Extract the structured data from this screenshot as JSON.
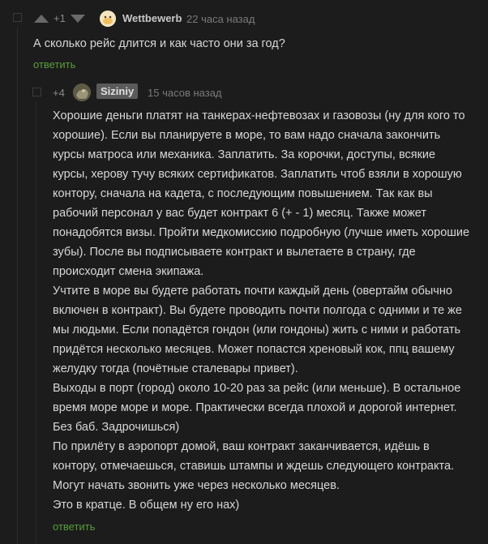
{
  "comment1": {
    "score": "+1",
    "username": "Wettbewerb",
    "time": "22 часа назад",
    "text": "А сколько рейс длится и как часто они за год?",
    "reply_label": "ответить"
  },
  "comment2": {
    "score": "+4",
    "username": "Siziniy",
    "time": "15 часов назад",
    "lines": [
      "Хорошие деньги платят на танкерах-нефтевозах и газовозы (ну для кого то",
      "хорошие). Если вы планируете в море, то вам надо сначала закончить",
      "курсы матроса или механика. Заплатить. За корочки, доступы, всякие",
      "курсы, херову тучу всяких сертификатов. Заплатить чтоб взяли в хорошую",
      "контору, сначала на кадета, с последующим повышением. Так как вы",
      "рабочий персонал у вас будет контракт 6 (+ - 1) месяц. Также может",
      "понадобятся визы. Пройти медкомиссию подробную (лучше иметь хорошие",
      "зубы). После вы подписываете контракт и вылетаете в страну, где",
      "происходит смена экипажа.",
      "Учтите в море вы будете работать почти каждый день (овертайм обычно",
      "включен в контракт). Вы будете проводить почти полгода с одними и те же",
      "мы людьми. Если попадётся гондон (или гондоны) жить с ними и работать",
      "придётся несколько месяцев. Может попастся хреновый кок, ппц вашему",
      "желудку тогда (почётные сталевары привет).",
      "Выходы в порт (город) около 10-20 раз за рейс (или меньше). В остальное",
      "время море море и море. Практически всегда плохой и дорогой интернет.",
      "Без баб. Задрочишься)",
      "По прилёту в аэропорт домой, ваш контракт заканчивается, идёшь в",
      "контору, отмечаешься, ставишь штампы и ждешь следующего контракта.",
      "Могут начать звонить уже через несколько месяцев.",
      "Это в кратце. В общем ну его нах)"
    ],
    "reply_label": "ответить"
  },
  "colors": {
    "background": "#1c1c1c",
    "text": "#d7d7d7",
    "reply": "#5a9e3a",
    "badge": "#5a5a5a"
  }
}
